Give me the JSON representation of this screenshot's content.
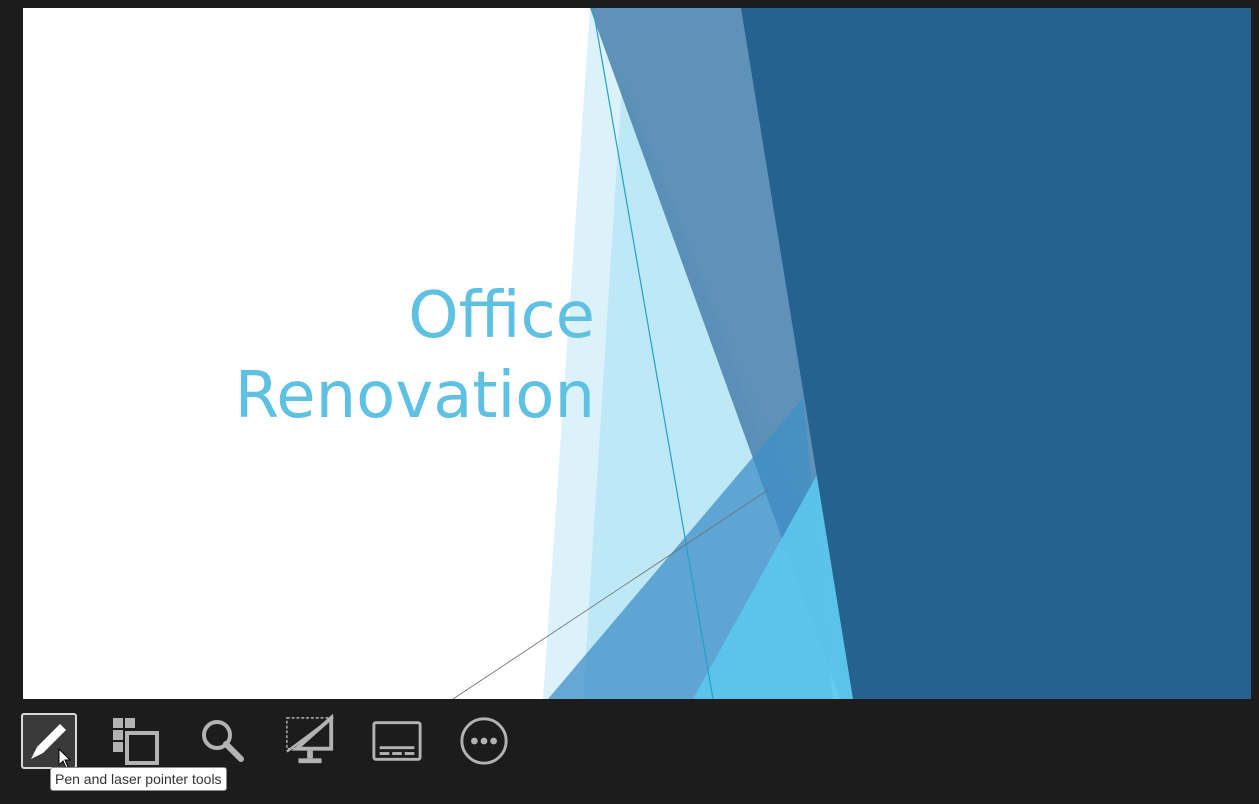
{
  "slide": {
    "title_lines": [
      "Office",
      "Renovation"
    ],
    "title_color": "#5ec1e3",
    "background_color": "#ffffff",
    "accent_dark": "#26628f",
    "accent_mid": "#4f86b0",
    "accent_light": "#5bc3ea"
  },
  "toolbar": {
    "buttons": [
      {
        "id": "pen",
        "icon": "pen-icon",
        "active": true
      },
      {
        "id": "all-slides",
        "icon": "slides-grid-icon",
        "active": false
      },
      {
        "id": "zoom",
        "icon": "magnifier-icon",
        "active": false
      },
      {
        "id": "black-screen",
        "icon": "monitor-slash-icon",
        "active": false
      },
      {
        "id": "subtitles",
        "icon": "subtitles-icon",
        "active": false
      },
      {
        "id": "more",
        "icon": "more-options-icon",
        "active": false
      }
    ]
  },
  "tooltip": {
    "text": "Pen and laser pointer tools"
  }
}
